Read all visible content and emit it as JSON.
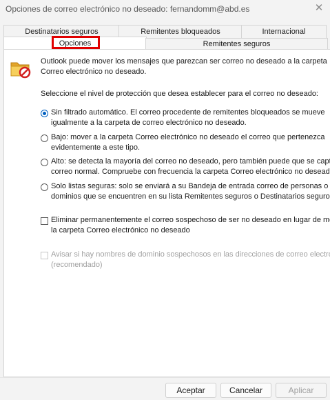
{
  "window": {
    "title": "Opciones de correo electrónico no deseado: fernandomm@abd.es",
    "close_glyph": "✕"
  },
  "tabs": {
    "row1": [
      "Destinatarios seguros",
      "Remitentes bloqueados",
      "Internacional"
    ],
    "row2": [
      "Opciones",
      "Remitentes seguros"
    ],
    "active": "Opciones"
  },
  "options": {
    "intro_line1": "Outlook puede mover los mensajes que parezcan ser correo no deseado a la carpeta",
    "intro_line2": "Correo electrónico no deseado.",
    "level_prompt": "Seleccione el nivel de protección que desea establecer para el correo no deseado:",
    "levels": [
      {
        "line1": "Sin filtrado automático. El correo procedente de remitentes bloqueados se mueve",
        "line2": "igualmente a la carpeta de correo electrónico no deseado.",
        "checked": true
      },
      {
        "line1": "Bajo: mover a la carpeta Correo electrónico no deseado el correo que pertenezca",
        "line2": "evidentemente a este tipo.",
        "checked": false
      },
      {
        "line1": "Alto: se detecta la mayoría del correo no deseado, pero también puede que se capture",
        "line2": "correo normal. Compruebe con frecuencia la carpeta Correo electrónico no deseado.",
        "checked": false
      },
      {
        "line1": "Solo listas seguras: solo se enviará a su Bandeja de entrada correo de personas o",
        "line2": "dominios que se encuentren en su lista Remitentes seguros o Destinatarios seguros.",
        "checked": false
      }
    ],
    "delete_permanently": {
      "line1": "Eliminar permanentemente el correo sospechoso de ser no deseado en lugar de moverlo a",
      "line2": "la carpeta Correo electrónico no deseado",
      "checked": false
    },
    "warn_domains": {
      "line1": "Avisar si hay nombres de dominio sospechosos en las direcciones de correo electrónico",
      "line2": "(recomendado)",
      "checked": false,
      "disabled": true
    }
  },
  "buttons": {
    "accept": "Aceptar",
    "cancel": "Cancelar",
    "apply": "Aplicar"
  },
  "colors": {
    "highlight": "#e00000",
    "accent": "#0060c0"
  }
}
